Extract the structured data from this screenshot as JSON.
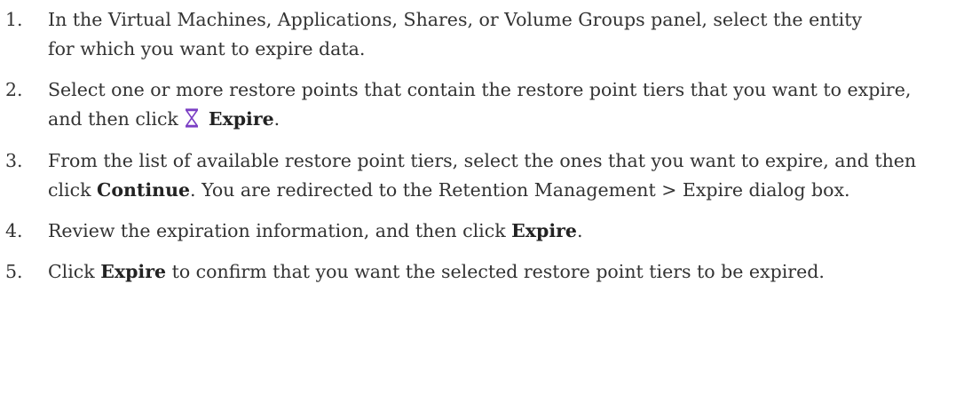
{
  "steps": [
    {
      "number": "1.",
      "text": "In the Virtual Machines, Applications, Shares, or Volume Groups panel, select the entity for which you want to expire data."
    },
    {
      "number": "2.",
      "text_before": "Select one or more restore points that contain the restore point tiers that you want to expire, and then click",
      "icon": "hourglass-icon",
      "icon_color": "#7b3fc4",
      "bold": "Expire",
      "text_after": "."
    },
    {
      "number": "3.",
      "text_before": "From the list of available restore point tiers, select the ones that you want to expire, and then click",
      "bold": "Continue",
      "text_after": ". You are redirected to the Retention Management > Expire dialog box."
    },
    {
      "number": "4.",
      "text_before": "Review the expiration information, and then click",
      "bold": "Expire",
      "text_after": "."
    },
    {
      "number": "5.",
      "text_before": "Click",
      "bold": "Expire",
      "text_after": "to confirm that you want the selected restore point tiers to be expired."
    }
  ]
}
